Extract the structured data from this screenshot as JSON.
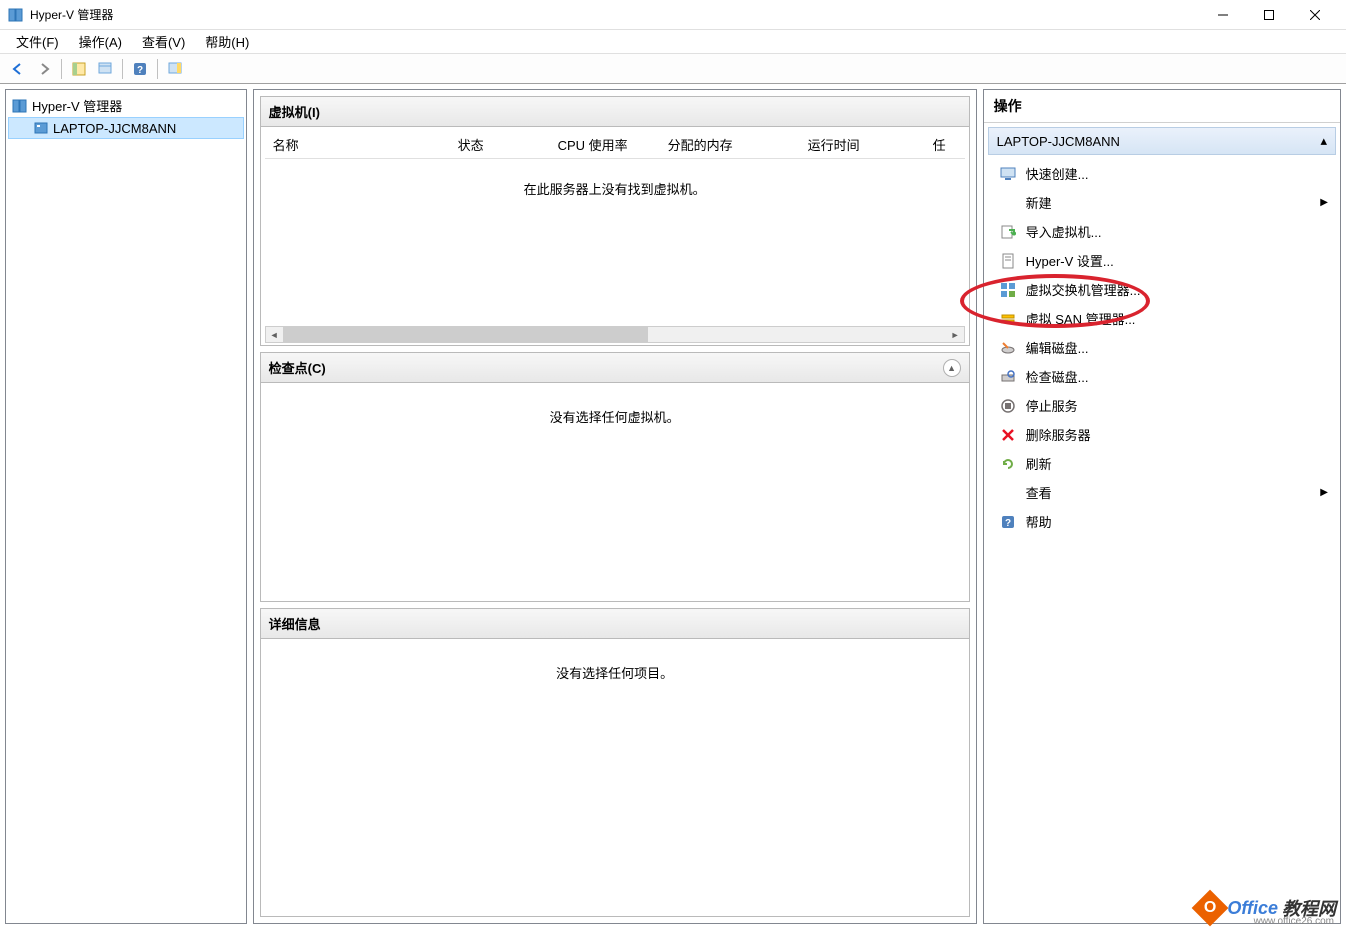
{
  "titlebar": {
    "title": "Hyper-V 管理器"
  },
  "menu": {
    "file": "文件(F)",
    "action": "操作(A)",
    "view": "查看(V)",
    "help": "帮助(H)"
  },
  "tree": {
    "root": "Hyper-V 管理器",
    "child": "LAPTOP-JJCM8ANN"
  },
  "vm_panel": {
    "title": "虚拟机(I)",
    "cols": {
      "name": "名称",
      "state": "状态",
      "cpu": "CPU 使用率",
      "mem": "分配的内存",
      "uptime": "运行时间",
      "task": "任"
    },
    "empty": "在此服务器上没有找到虚拟机。"
  },
  "cp_panel": {
    "title": "检查点(C)",
    "empty": "没有选择任何虚拟机。"
  },
  "detail_panel": {
    "title": "详细信息",
    "empty": "没有选择任何项目。"
  },
  "actions": {
    "title": "操作",
    "group": "LAPTOP-JJCM8ANN",
    "items": {
      "quick_create": "快速创建...",
      "new": "新建",
      "import_vm": "导入虚拟机...",
      "hyperv_settings": "Hyper-V 设置...",
      "vswitch_mgr": "虚拟交换机管理器...",
      "vsan_mgr": "虚拟 SAN 管理器...",
      "edit_disk": "编辑磁盘...",
      "inspect_disk": "检查磁盘...",
      "stop_service": "停止服务",
      "remove_server": "删除服务器",
      "refresh": "刷新",
      "view": "查看",
      "help": "帮助"
    }
  },
  "watermark": {
    "brand1": "Office",
    "brand2": "教程网",
    "url": "www.office26.com"
  }
}
